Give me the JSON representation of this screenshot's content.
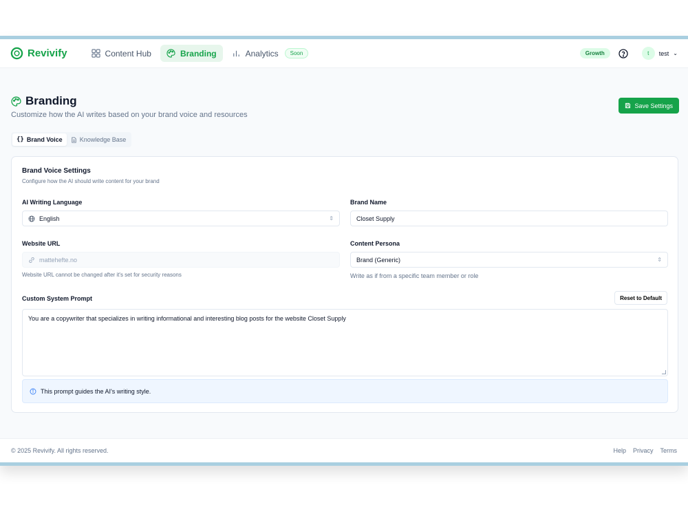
{
  "app": {
    "name": "Revivify"
  },
  "nav": {
    "items": [
      {
        "label": "Content Hub"
      },
      {
        "label": "Branding"
      },
      {
        "label": "Analytics",
        "badge": "Soon"
      }
    ]
  },
  "topbar": {
    "plan": "Growth",
    "user_initial": "t",
    "user_name": "test"
  },
  "page": {
    "title": "Branding",
    "subtitle": "Customize how the AI writes based on your brand voice and resources",
    "save_label": "Save Settings"
  },
  "tabs": [
    {
      "label": "Brand Voice"
    },
    {
      "label": "Knowledge Base"
    }
  ],
  "card": {
    "title": "Brand Voice Settings",
    "subtitle": "Configure how the AI should write content for your brand"
  },
  "form": {
    "language": {
      "label": "AI Writing Language",
      "value": "English"
    },
    "brand_name": {
      "label": "Brand Name",
      "value": "Closet Supply"
    },
    "website": {
      "label": "Website URL",
      "value": "mattehefte.no",
      "hint": "Website URL cannot be changed after it's set for security reasons"
    },
    "persona": {
      "label": "Content Persona",
      "value": "Brand (Generic)",
      "hint": "Write as if from a specific team member or role"
    },
    "prompt": {
      "label": "Custom System Prompt",
      "reset_label": "Reset to Default",
      "value": "You are a copywriter that specializes in writing informational and interesting blog posts for the website Closet Supply",
      "info": "This prompt guides the AI's writing style."
    }
  },
  "footer": {
    "copyright": "© 2025 Revivify. All rights reserved.",
    "links": [
      "Help",
      "Privacy",
      "Terms"
    ]
  },
  "colors": {
    "accent": "#16a34a",
    "accent_soft": "#e7f6ec",
    "info_bg": "#eff6ff"
  }
}
